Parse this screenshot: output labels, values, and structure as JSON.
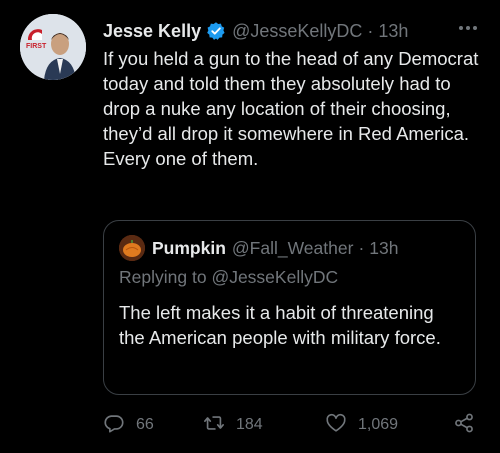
{
  "tweet": {
    "author": {
      "display_name": "Jesse Kelly",
      "handle": "@JesseKellyDC",
      "time": "13h",
      "verified": true,
      "avatar_badge_text": "FIRST"
    },
    "separator": "·",
    "text": "If you held a gun to the head of any Democrat today and told them they absolutely had to drop a nuke any location of their choosing, they’d all drop it somewhere in Red America. Every one of them.",
    "quoted": {
      "author": {
        "display_name": "Pumpkin",
        "handle": "@Fall_Weather",
        "time": "13h"
      },
      "replying_to_label": "Replying to",
      "replying_to_handle": "@JesseKellyDC",
      "text": "The left makes it a habit of threatening the American people with military force."
    },
    "actions": {
      "reply_count": "66",
      "retweet_count": "184",
      "like_count": "1,069"
    }
  },
  "colors": {
    "background": "#000000",
    "text_primary": "#e7e9ea",
    "text_secondary": "#71767b",
    "verified_blue": "#1d9bf0",
    "quote_border": "#3a3f44"
  },
  "icons": {
    "more": "more-dots-icon",
    "verified": "verified-badge-icon",
    "reply": "reply-bubble-icon",
    "retweet": "retweet-icon",
    "like": "heart-icon",
    "share": "share-icon"
  }
}
